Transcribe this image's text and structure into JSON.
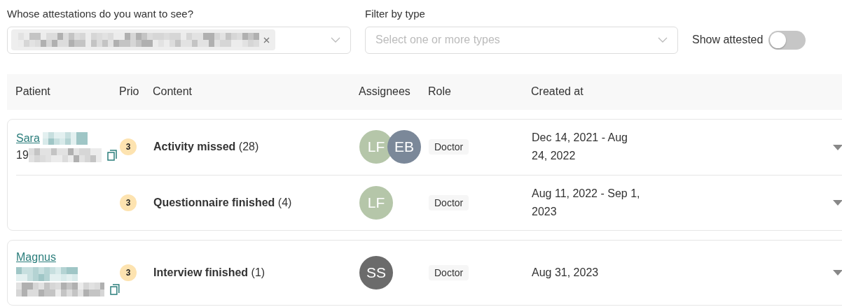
{
  "filters": {
    "patient_label": "Whose attestations do you want to see?",
    "type_label": "Filter by type",
    "type_placeholder": "Select one or more types",
    "show_attested_label": "Show attested",
    "show_attested_on": false
  },
  "table": {
    "columns": [
      "Patient",
      "Prio",
      "Content",
      "Assignees",
      "Role",
      "Created at"
    ],
    "groups": [
      {
        "patient_name": "Sara",
        "patient_id": "19",
        "rows": [
          {
            "prio": "3",
            "title": "Activity missed",
            "count": "(28)",
            "assignees": [
              {
                "initials": "LF",
                "color": "#b5c6a9"
              },
              {
                "initials": "EB",
                "color": "#7b8899"
              }
            ],
            "role": "Doctor",
            "created": "Dec 14, 2021 - Aug 24, 2022"
          },
          {
            "prio": "3",
            "title": "Questionnaire finished",
            "count": "(4)",
            "assignees": [
              {
                "initials": "LF",
                "color": "#b5c6a9"
              }
            ],
            "role": "Doctor",
            "created": "Aug 11, 2022 - Sep 1, 2023"
          }
        ]
      },
      {
        "patient_name": "Magnus",
        "rows": [
          {
            "prio": "3",
            "title": "Interview finished",
            "count": "(1)",
            "assignees": [
              {
                "initials": "SS",
                "color": "#6b6b6b"
              }
            ],
            "role": "Doctor",
            "created": "Aug 31, 2023"
          }
        ]
      }
    ]
  }
}
